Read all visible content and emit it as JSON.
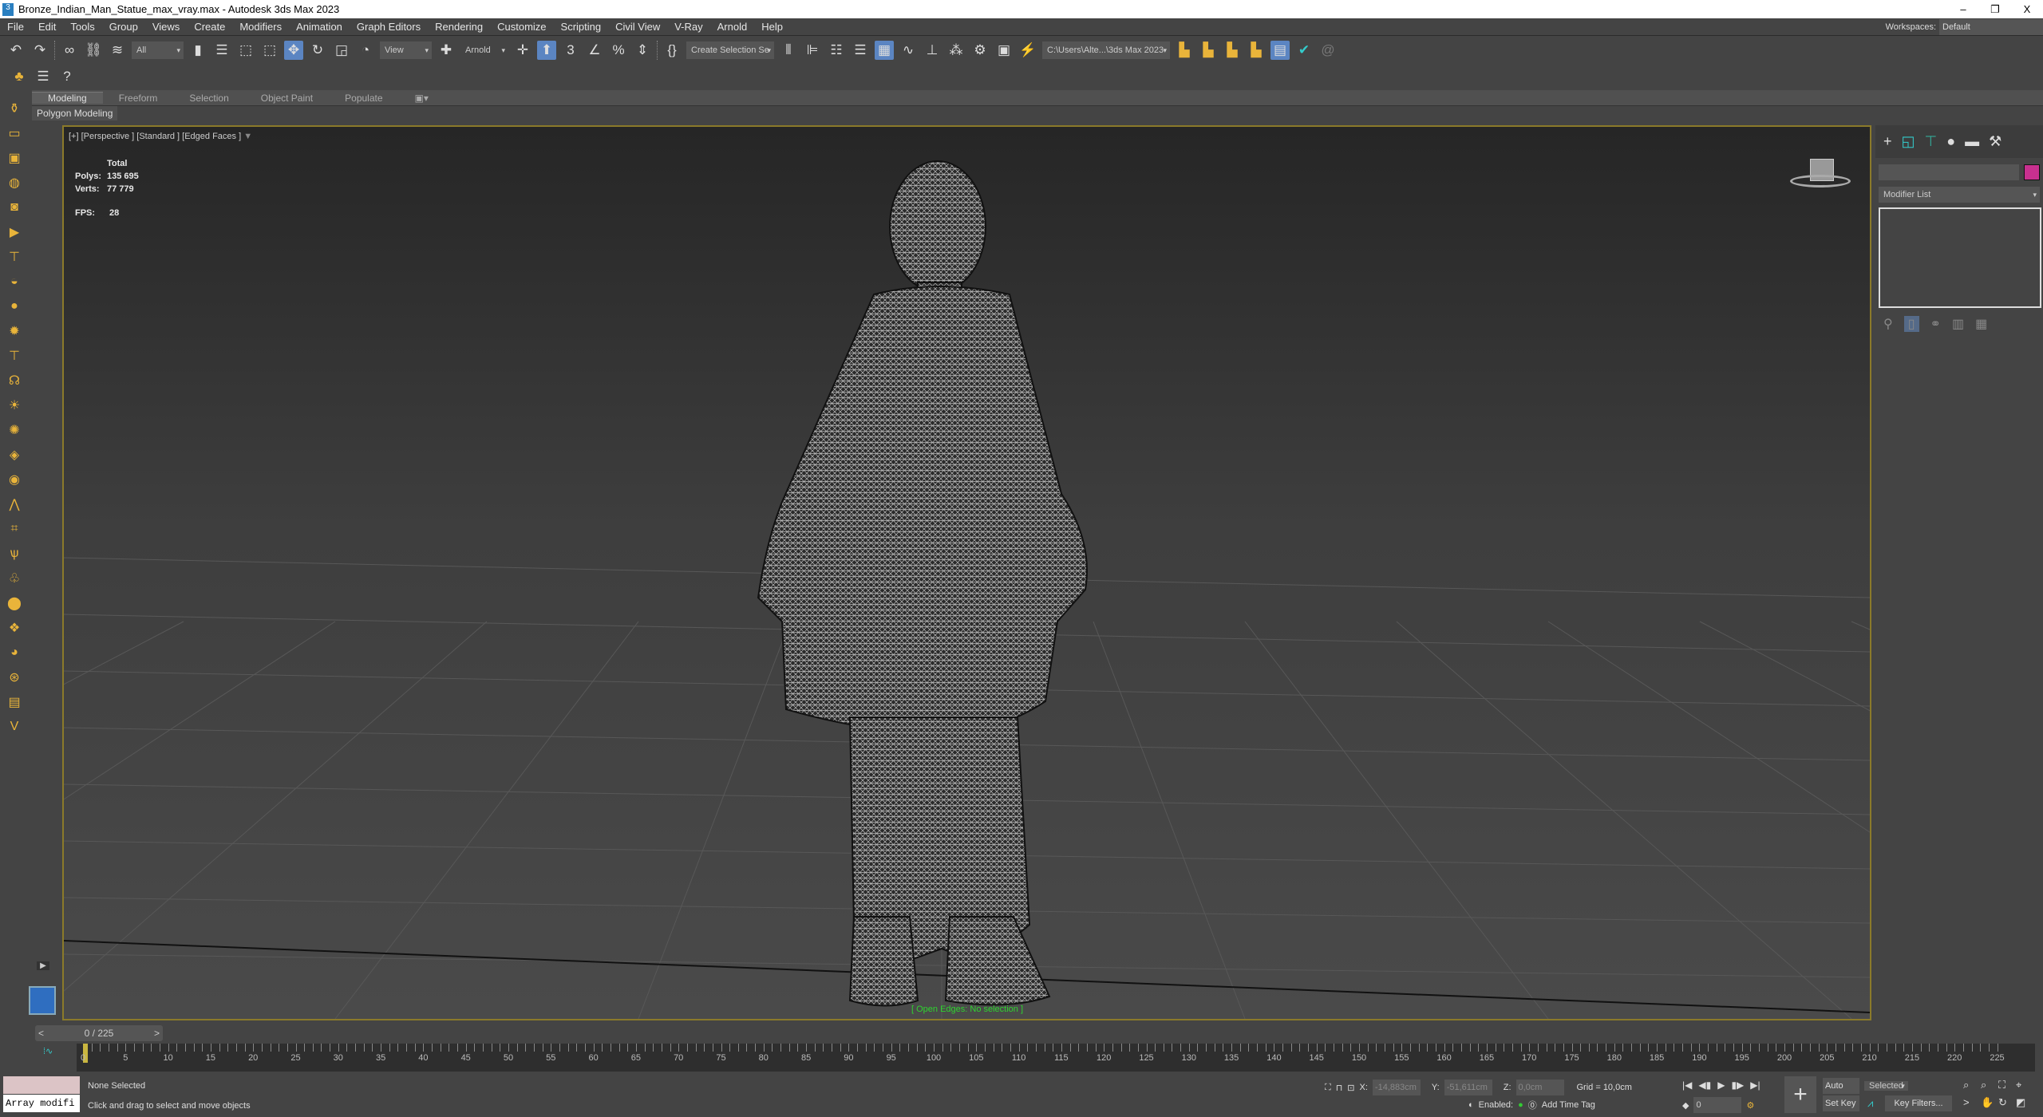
{
  "window": {
    "title": "Bronze_Indian_Man_Statue_max_vray.max - Autodesk 3ds Max 2023",
    "minimize": "–",
    "restore": "❐",
    "close": "X"
  },
  "menu": [
    "File",
    "Edit",
    "Tools",
    "Group",
    "Views",
    "Create",
    "Modifiers",
    "Animation",
    "Graph Editors",
    "Rendering",
    "Customize",
    "Scripting",
    "Civil View",
    "V-Ray",
    "Arnold",
    "Help"
  ],
  "workspaces": {
    "label": "Workspaces:",
    "value": "Default"
  },
  "toolbar": {
    "selection_filter": "All",
    "ref_coord": "View",
    "arnold": "Arnold",
    "named_selection": "Create Selection Se",
    "project_path": "C:\\Users\\Alte...\\3ds Max 2023"
  },
  "ribbon": {
    "tabs": [
      "Modeling",
      "Freeform",
      "Selection",
      "Object Paint",
      "Populate"
    ],
    "active": "Modeling",
    "panel": "Polygon Modeling"
  },
  "viewport": {
    "label": "[+] [Perspective ] [Standard ] [Edged Faces ]",
    "stats": {
      "header": "Total",
      "polys_label": "Polys:",
      "polys": "135 695",
      "verts_label": "Verts:",
      "verts": "77 779",
      "fps_label": "FPS:",
      "fps": "28"
    },
    "open_edges": "[ Open Edges: No selection ]"
  },
  "command_panel": {
    "modifier_list": "Modifier List",
    "object_color": "#c8308f"
  },
  "timeline": {
    "slider": "0 / 225",
    "labels": [
      "0",
      "5",
      "10",
      "15",
      "20",
      "25",
      "30",
      "35",
      "40",
      "45",
      "50",
      "55",
      "60",
      "65",
      "70",
      "75",
      "80",
      "85",
      "90",
      "95",
      "100",
      "105",
      "110",
      "115",
      "120",
      "125",
      "130",
      "135",
      "140",
      "145",
      "150",
      "155",
      "160",
      "165",
      "170",
      "175",
      "180",
      "185",
      "190",
      "195",
      "200",
      "205",
      "210",
      "215",
      "220",
      "225"
    ]
  },
  "status": {
    "maxscript": "Array modifi",
    "selection": "None Selected",
    "prompt": "Click and drag to select and move objects",
    "x_label": "X:",
    "x": "-14,883cm",
    "y_label": "Y:",
    "y": "-51,611cm",
    "z_label": "Z:",
    "z": "0,0cm",
    "grid": "Grid = 10,0cm",
    "enabled": "Enabled:",
    "add_time_tag": "Add Time Tag",
    "frame": "0",
    "auto_key": "Auto Key",
    "set_key": "Set Key",
    "key_mode": "Selected",
    "key_filters": "Key Filters..."
  },
  "colors": {
    "viewport_border": "#8b7a2a",
    "active_button": "#5b85c2",
    "open_edges_text": "#2fd42f"
  }
}
